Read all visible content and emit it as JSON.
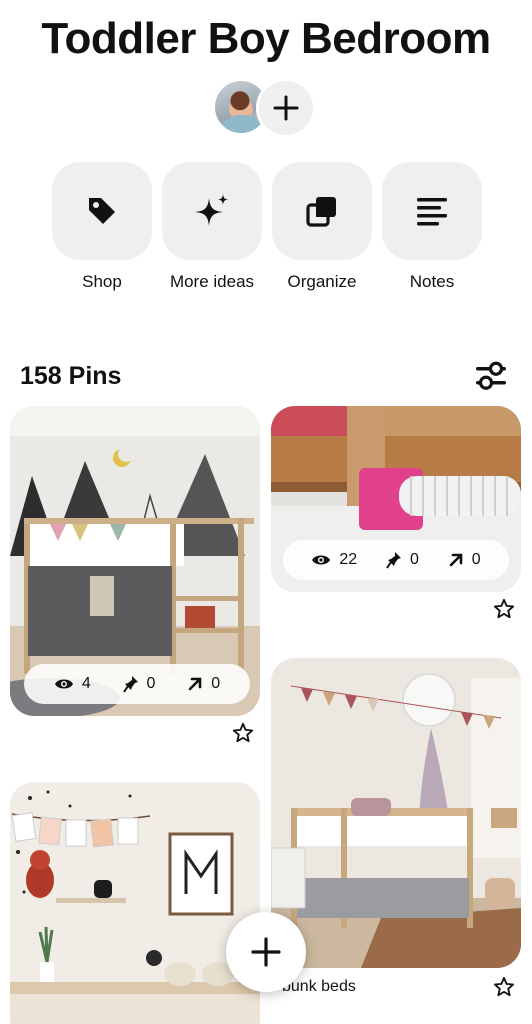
{
  "board": {
    "title": "Toddler Boy Bedroom"
  },
  "collaborators": {
    "add_label": "+"
  },
  "actions": [
    {
      "label": "Shop",
      "icon": "tag-icon"
    },
    {
      "label": "More ideas",
      "icon": "sparkle-icon"
    },
    {
      "label": "Organize",
      "icon": "organize-icon"
    },
    {
      "label": "Notes",
      "icon": "notes-icon"
    }
  ],
  "pins_header": {
    "count_label": "158 Pins"
  },
  "pins": [
    {
      "stats": {
        "views": "4",
        "saves": "0",
        "clicks": "0"
      }
    },
    {
      "stats": {
        "views": "22",
        "saves": "0",
        "clicks": "0"
      }
    },
    {
      "caption": "bunk beds"
    },
    {
      "caption": ""
    }
  ],
  "colors": {
    "tile_bg": "#efefef",
    "text": "#111111",
    "accent_pink": "#e0408c"
  }
}
